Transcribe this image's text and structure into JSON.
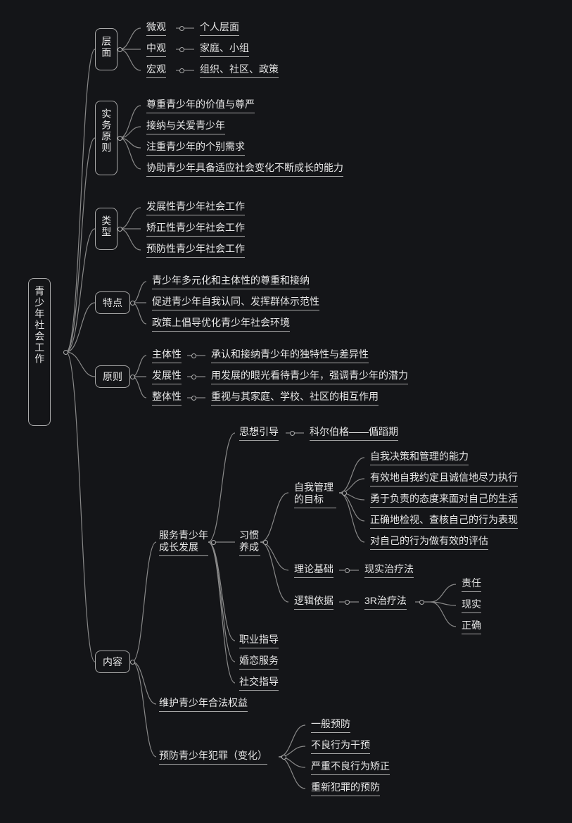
{
  "root": "青少年社会工作",
  "b1": {
    "title": "层面",
    "items": [
      {
        "k": "微观",
        "v": "个人层面"
      },
      {
        "k": "中观",
        "v": "家庭、小组"
      },
      {
        "k": "宏观",
        "v": "组织、社区、政策"
      }
    ]
  },
  "b2": {
    "title": "实务原则",
    "items": [
      "尊重青少年的价值与尊严",
      "接纳与关爱青少年",
      "注重青少年的个别需求",
      "协助青少年具备适应社会变化不断成长的能力"
    ]
  },
  "b3": {
    "title": "类型",
    "items": [
      "发展性青少年社会工作",
      "矫正性青少年社会工作",
      "预防性青少年社会工作"
    ]
  },
  "b4": {
    "title": "特点",
    "items": [
      "青少年多元化和主体性的尊重和接纳",
      "促进青少年自我认同、发挥群体示范性",
      "政策上倡导优化青少年社会环境"
    ]
  },
  "b5": {
    "title": "原则",
    "items": [
      {
        "k": "主体性",
        "v": "承认和接纳青少年的独特性与差异性"
      },
      {
        "k": "发展性",
        "v": "用发展的眼光看待青少年，强调青少年的潜力"
      },
      {
        "k": "整体性",
        "v": "重视与其家庭、学校、社区的相互作用"
      }
    ]
  },
  "b6": {
    "title": "内容",
    "c1": "服务青少年成长发展",
    "c1a": {
      "k": "思想引导",
      "v": "科尔伯格——偱蹈期"
    },
    "c1b": {
      "title": "习惯养成",
      "g1": {
        "title": "自我管理的目标",
        "items": [
          "自我决策和管理的能力",
          "有效地自我约定且诚信地尽力执行",
          "勇于负责的态度来面对自己的生活",
          "正确地检视、查核自己的行为表现",
          "对自己的行为做有效的评估"
        ]
      },
      "g2": {
        "k": "理论基础",
        "v": "现实治疗法"
      },
      "g3": {
        "k": "逻辑依据",
        "v": "3R治疗法",
        "items": [
          "责任",
          "现实",
          "正确"
        ]
      }
    },
    "c1c": [
      "职业指导",
      "婚恋服务",
      "社交指导"
    ],
    "c2": "维护青少年合法权益",
    "c3": {
      "title": "预防青少年犯罪（变化）",
      "items": [
        "一般预防",
        "不良行为干预",
        "严重不良行为矫正",
        "重新犯罪的预防"
      ]
    }
  }
}
